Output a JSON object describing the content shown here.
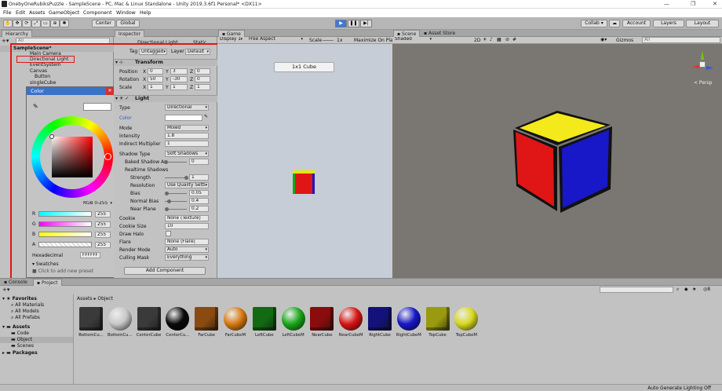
{
  "window": {
    "title": "OnebyOneRubiksPuzzle - SampleScene - PC, Mac & Linux Standalone - Unity 2019.3.6f1 Personal* <DX11>"
  },
  "menu": [
    "File",
    "Edit",
    "Assets",
    "GameObject",
    "Component",
    "Window",
    "Help"
  ],
  "toolbar": {
    "pivot_label": "Center",
    "space_label": "Global",
    "collab_label": "Collab ▾",
    "account_label": "Account",
    "layers_label": "Layers",
    "layout_label": "Layout"
  },
  "hierarchy": {
    "tab": "Hierarchy",
    "search_placeholder": "All",
    "items": [
      "SampleScene*",
      "Main Camera",
      "Directional Light",
      "EventSystem",
      "Canvas",
      "Button",
      "singleCube"
    ]
  },
  "color_picker": {
    "title": "Color",
    "mode": "RGB 0-255",
    "r_label": "R",
    "r_value": "255",
    "g_label": "G",
    "g_value": "255",
    "b_label": "B",
    "b_value": "255",
    "a_label": "A",
    "a_value": "255",
    "hex_label": "Hexadecimal",
    "hex_value": "FFFFFF",
    "swatches_label": "Swatches",
    "preset_hint": "Click to add new preset"
  },
  "inspector": {
    "tab": "Inspector",
    "object_name": "Directional Light",
    "static_label": "Static",
    "tag_label": "Tag",
    "tag_value": "Untagged",
    "layer_label": "Layer",
    "layer_value": "Default",
    "transform": {
      "title": "Transform",
      "position_label": "Position",
      "pos_x": "0",
      "pos_y": "3",
      "pos_z": "0",
      "rotation_label": "Rotation",
      "rot_x": "50",
      "rot_y": "-30",
      "rot_z": "0",
      "scale_label": "Scale",
      "scl_x": "1",
      "scl_y": "1",
      "scl_z": "1"
    },
    "light": {
      "title": "Light",
      "type_label": "Type",
      "type_value": "Directional",
      "color_label": "Color",
      "mode_label": "Mode",
      "mode_value": "Mixed",
      "intensity_label": "Intensity",
      "intensity_value": "1.8",
      "indirect_label": "Indirect Multiplier",
      "indirect_value": "1",
      "shadow_type_label": "Shadow Type",
      "shadow_type_value": "Soft Shadows",
      "baked_label": "Baked Shadow An",
      "baked_value": "0",
      "realtime_label": "Realtime Shadows",
      "strength_label": "Strength",
      "strength_value": "1",
      "resolution_label": "Resolution",
      "resolution_value": "Use Quality Setti",
      "bias_label": "Bias",
      "bias_value": "0.05",
      "normal_bias_label": "Normal Bias",
      "normal_bias_value": "0.4",
      "near_plane_label": "Near Plane",
      "near_plane_value": "0.2",
      "cookie_label": "Cookie",
      "cookie_value": "None (Texture)",
      "cookie_size_label": "Cookie Size",
      "cookie_size_value": "10",
      "draw_halo_label": "Draw Halo",
      "flare_label": "Flare",
      "flare_value": "None (Flare)",
      "render_mode_label": "Render Mode",
      "render_mode_value": "Auto",
      "culling_label": "Culling Mask",
      "culling_value": "Everything"
    },
    "add_component": "Add Component"
  },
  "game": {
    "tab": "Game",
    "display": "Display 1",
    "aspect": "Free Aspect",
    "scale_label": "Scale",
    "scale_value": "1x",
    "maximize": "Maximize On Play",
    "button_text": "1x1 Cube"
  },
  "scene": {
    "tab": "Scene",
    "asset_store_tab": "Asset Store",
    "shading": "Shaded",
    "mode_2d": "2D",
    "gizmos": "Gizmos",
    "search_placeholder": "All",
    "persp": "< Persp"
  },
  "project": {
    "console_tab": "Console",
    "project_tab": "Project",
    "favorites": "Favorites",
    "fav_items": [
      "All Materials",
      "All Models",
      "All Prefabs"
    ],
    "assets": "Assets",
    "asset_folders": [
      "Code",
      "Object",
      "Scenes"
    ],
    "packages": "Packages",
    "breadcrumb_root": "Assets",
    "breadcrumb_current": "Object",
    "hidden_count": "8",
    "items": [
      {
        "name": "BottomCu...",
        "color": "#3a3a3a",
        "shape": "cube"
      },
      {
        "name": "BottomCu...",
        "color": "#c8c8c8",
        "shape": "sphere"
      },
      {
        "name": "CenterCube",
        "color": "#3a3a3a",
        "shape": "cube"
      },
      {
        "name": "CenterCu...",
        "color": "#0a0a0a",
        "shape": "sphere"
      },
      {
        "name": "FarCube",
        "color": "#8a4a10",
        "shape": "cube"
      },
      {
        "name": "FarCubeM",
        "color": "#d87a14",
        "shape": "sphere"
      },
      {
        "name": "LeftCube",
        "color": "#126a12",
        "shape": "cube"
      },
      {
        "name": "LeftCubeM",
        "color": "#1aa81a",
        "shape": "sphere"
      },
      {
        "name": "NearCube",
        "color": "#8a0c0c",
        "shape": "cube"
      },
      {
        "name": "NearCubeM",
        "color": "#d81616",
        "shape": "sphere"
      },
      {
        "name": "RightCube",
        "color": "#12127a",
        "shape": "cube"
      },
      {
        "name": "RightCubeM",
        "color": "#1818c8",
        "shape": "sphere"
      },
      {
        "name": "TopCube",
        "color": "#9a9a10",
        "shape": "cube"
      },
      {
        "name": "TopCubeM",
        "color": "#d8d820",
        "shape": "sphere"
      }
    ]
  },
  "statusbar": {
    "text": "Auto Generate Lighting Off"
  },
  "colors": {
    "highlight": "#e0161a",
    "selection": "#3a72c8",
    "scene_bg": "#7a7672",
    "game_bg": "#c6cdd6"
  }
}
